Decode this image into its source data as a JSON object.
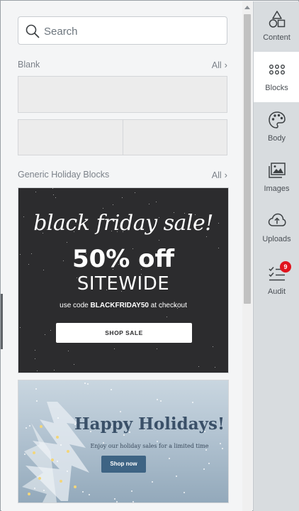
{
  "search": {
    "placeholder": "Search"
  },
  "sections": {
    "blank": {
      "title": "Blank",
      "all_label": "All"
    },
    "holiday": {
      "title": "Generic Holiday Blocks",
      "all_label": "All"
    }
  },
  "blocks": {
    "black_friday": {
      "headline": "black friday sale!",
      "discount": "50% off",
      "scope": "SITEWIDE",
      "code_prefix": "use code ",
      "code": "BLACKFRIDAY50",
      "code_suffix": " at checkout",
      "button": "SHOP SALE"
    },
    "holidays": {
      "title": "Happy Holidays!",
      "subtitle": "Enjoy our holiday sales for a limited time",
      "button": "Shop now"
    }
  },
  "sidebar": {
    "tabs": [
      {
        "label": "Content",
        "icon": "shapes-icon"
      },
      {
        "label": "Blocks",
        "icon": "grid-dots-icon",
        "active": true
      },
      {
        "label": "Body",
        "icon": "palette-icon"
      },
      {
        "label": "Images",
        "icon": "images-icon"
      },
      {
        "label": "Uploads",
        "icon": "cloud-upload-icon"
      },
      {
        "label": "Audit",
        "icon": "checklist-icon",
        "badge": "9"
      }
    ]
  },
  "colors": {
    "sidebar_bg": "#d8dcdf",
    "panel_bg": "#f4f5f6",
    "black_friday_bg": "#2c2c2e",
    "holiday_button": "#3e6484",
    "badge": "#e0141e"
  }
}
